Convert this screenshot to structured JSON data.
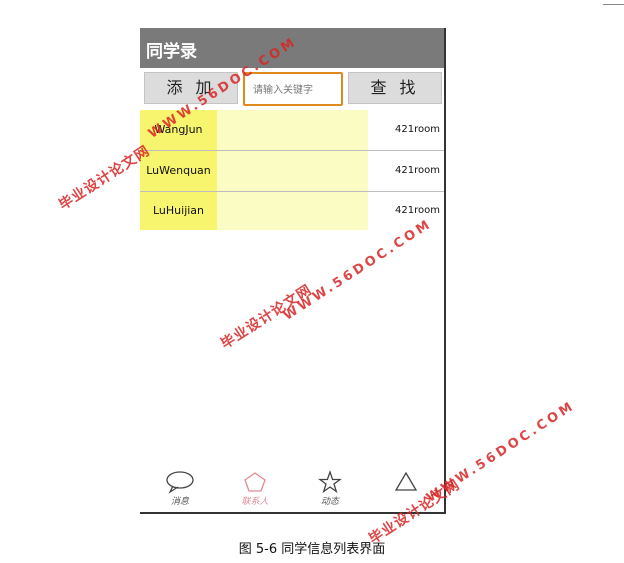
{
  "app": {
    "title": "同学录"
  },
  "toolbar": {
    "add_label": "添 加",
    "search_placeholder": "请输入关键字",
    "find_label": "查 找"
  },
  "contacts": [
    {
      "name": "WangJun",
      "room": "421room"
    },
    {
      "name": "LuWenquan",
      "room": "421room"
    },
    {
      "name": "LuHuijian",
      "room": "421room"
    }
  ],
  "tabs": [
    {
      "label": "消息",
      "icon": "speech-bubble-icon"
    },
    {
      "label": "联系人",
      "icon": "pentagon-icon"
    },
    {
      "label": "动态",
      "icon": "star-icon"
    },
    {
      "label": "",
      "icon": "triangle-icon"
    }
  ],
  "caption": "图 5-6 同学信息列表界面",
  "watermark": {
    "cn": "毕业设计论文网",
    "en": "WWW.56DOC.COM"
  },
  "colors": {
    "appbar": "#7a7a7a",
    "search_border": "#e08a1e",
    "name_highlight": "#f7f46e",
    "row_highlight": "#fbfcc4",
    "watermark": "#d82626"
  }
}
